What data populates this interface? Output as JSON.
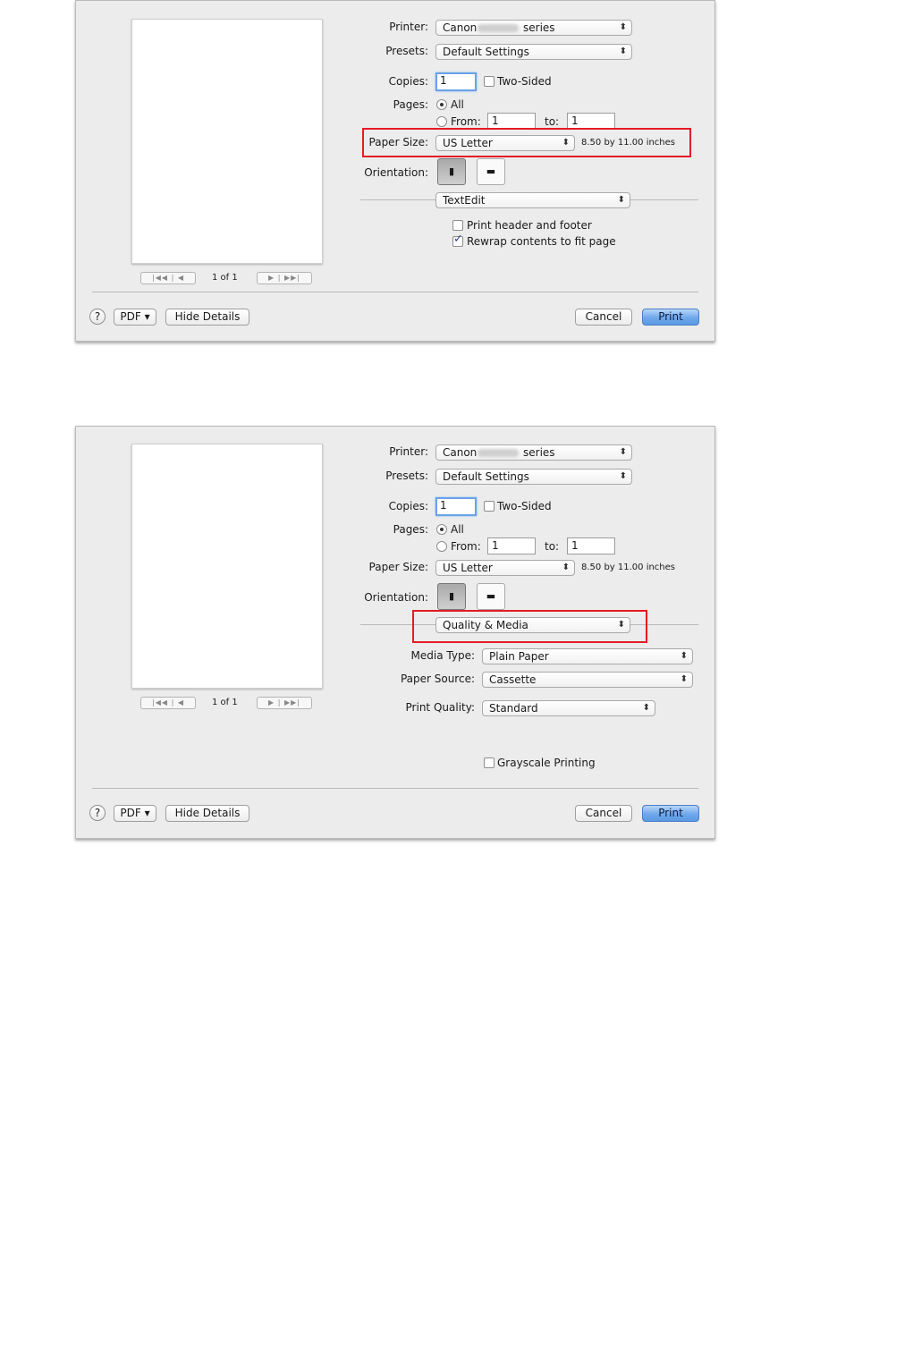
{
  "common": {
    "printer_label": "Printer:",
    "printer_value_prefix": "Canon",
    "printer_value_suffix": "series",
    "presets_label": "Presets:",
    "presets_value": "Default Settings",
    "copies_label": "Copies:",
    "copies_value": "1",
    "two_sided_label": "Two-Sided",
    "pages_label": "Pages:",
    "pages_all_label": "All",
    "pages_from_label": "From:",
    "pages_from_value": "1",
    "pages_to_label": "to:",
    "pages_to_value": "1",
    "paper_size_label": "Paper Size:",
    "paper_size_value": "US Letter",
    "paper_size_dims": "8.50 by 11.00 inches",
    "orientation_label": "Orientation:",
    "page_indicator": "1 of 1",
    "nav_first_prev": "|◀◀ | ◀",
    "nav_next_last": "▶ | ▶▶|",
    "help_glyph": "?",
    "pdf_label": "PDF ▾",
    "hide_details_label": "Hide Details",
    "cancel_label": "Cancel",
    "print_label": "Print",
    "popup_arrows": "⬍",
    "orient_portrait_glyph": "▮",
    "orient_landscape_glyph": "▬"
  },
  "dialog1": {
    "section_popup": "TextEdit",
    "print_header_footer_label": "Print header and footer",
    "rewrap_label": "Rewrap contents to fit page"
  },
  "dialog2": {
    "section_popup": "Quality & Media",
    "media_type_label": "Media Type:",
    "media_type_value": "Plain Paper",
    "paper_source_label": "Paper Source:",
    "paper_source_value": "Cassette",
    "print_quality_label": "Print Quality:",
    "print_quality_value": "Standard",
    "grayscale_label": "Grayscale Printing"
  },
  "highlight_color": "#e41c24",
  "print_button_color": "#6ea8ec"
}
